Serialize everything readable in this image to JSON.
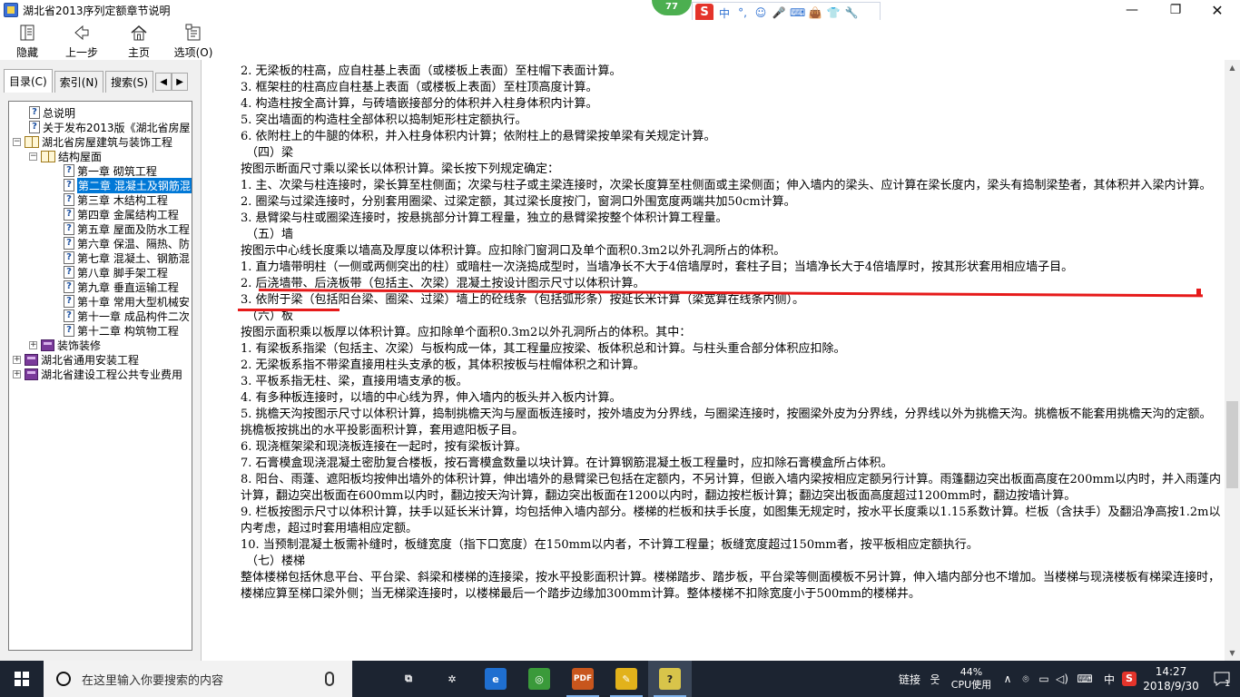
{
  "window": {
    "title": "湖北省2013序列定额章节说明",
    "minimize": "—",
    "maximize": "❐",
    "close": "✕"
  },
  "ime": {
    "badge": "77",
    "logo": "S",
    "items": [
      "中",
      "°,",
      "☺",
      "🎤",
      "⌨",
      "👜",
      "👕",
      "🔧"
    ]
  },
  "toolbar": {
    "hide_label": "隐藏",
    "back_label": "上一步",
    "home_label": "主页",
    "options_label": "选项(O)"
  },
  "nav": {
    "tabs": [
      "目录(C)",
      "索引(N)",
      "搜索(S)"
    ],
    "tab_prev": "◀",
    "tab_next": "▶",
    "tree": [
      {
        "indent": 0,
        "expander": "",
        "icon": "doc",
        "label": "总说明"
      },
      {
        "indent": 0,
        "expander": "",
        "icon": "doc",
        "label": "关于发布2013版《湖北省房屋"
      },
      {
        "indent": -1,
        "expander": "−",
        "icon": "book-open",
        "label": "湖北省房屋建筑与装饰工程"
      },
      {
        "indent": 1,
        "expander": "−",
        "icon": "book-open",
        "label": "结构屋面"
      },
      {
        "indent": 2,
        "expander": "",
        "icon": "doc",
        "label": "第一章  砌筑工程"
      },
      {
        "indent": 2,
        "expander": "",
        "icon": "doc",
        "label": "第二章  混凝土及钢筋混",
        "selected": true
      },
      {
        "indent": 2,
        "expander": "",
        "icon": "doc",
        "label": "第三章  木结构工程"
      },
      {
        "indent": 2,
        "expander": "",
        "icon": "doc",
        "label": "第四章  金属结构工程"
      },
      {
        "indent": 2,
        "expander": "",
        "icon": "doc",
        "label": "第五章  屋面及防水工程"
      },
      {
        "indent": 2,
        "expander": "",
        "icon": "doc",
        "label": "第六章  保温、隔热、防"
      },
      {
        "indent": 2,
        "expander": "",
        "icon": "doc",
        "label": "第七章  混凝土、钢筋混"
      },
      {
        "indent": 2,
        "expander": "",
        "icon": "doc",
        "label": "第八章  脚手架工程"
      },
      {
        "indent": 2,
        "expander": "",
        "icon": "doc",
        "label": "第九章  垂直运输工程"
      },
      {
        "indent": 2,
        "expander": "",
        "icon": "doc",
        "label": "第十章  常用大型机械安"
      },
      {
        "indent": 2,
        "expander": "",
        "icon": "doc",
        "label": "第十一章  成品构件二次"
      },
      {
        "indent": 2,
        "expander": "",
        "icon": "doc",
        "label": "第十二章  构筑物工程"
      },
      {
        "indent": 1,
        "expander": "+",
        "icon": "book",
        "label": "装饰装修"
      },
      {
        "indent": -1,
        "expander": "+",
        "icon": "book",
        "label": "湖北省通用安装工程"
      },
      {
        "indent": -1,
        "expander": "+",
        "icon": "book",
        "label": "湖北省建设工程公共专业费用"
      }
    ]
  },
  "content": {
    "lines": [
      {
        "text": "2. 无梁板的柱高，应自柱基上表面（或楼板上表面）至柱帽下表面计算。"
      },
      {
        "text": "3. 框架柱的柱高应自柱基上表面（或楼板上表面）至柱顶高度计算。"
      },
      {
        "text": "4. 构造柱按全高计算，与砖墙嵌接部分的体积并入柱身体积内计算。"
      },
      {
        "text": "5. 突出墙面的构造柱全部体积以捣制矩形柱定额执行。"
      },
      {
        "text": "6. 依附柱上的牛腿的体积，并入柱身体积内计算；依附柱上的悬臂梁按单梁有关规定计算。"
      },
      {
        "text": "（四）梁",
        "heading": true
      },
      {
        "text": "按图示断面尺寸乘以梁长以体积计算。梁长按下列规定确定："
      },
      {
        "text": "1. 主、次梁与柱连接时，梁长算至柱侧面；次梁与柱子或主梁连接时，次梁长度算至柱侧面或主梁侧面；伸入墙内的梁头、应计算在梁长度内，梁头有捣制梁垫者，其体积并入梁内计算。",
        "wrap": true
      },
      {
        "text": "2. 圈梁与过梁连接时，分别套用圈梁、过梁定额，其过梁长度按门，窗洞口外围宽度两端共加50cm计算。"
      },
      {
        "text": "3. 悬臂梁与柱或圈梁连接时，按悬挑部分计算工程量，独立的悬臂梁按整个体积计算工程量。"
      },
      {
        "text": "（五）墙",
        "heading": true
      },
      {
        "text": "按图示中心线长度乘以墙高及厚度以体积计算。应扣除门窗洞口及单个面积0.3m2以外孔洞所占的体积。"
      },
      {
        "text": "1. 直力墙带明柱（一侧或两侧突出的柱）或暗柱一次浇捣成型时，当墙净长不大于4倍墙厚时，套柱子目；当墙净长大于4倍墙厚时，按其形状套用相应墙子目。",
        "wrap": true
      },
      {
        "text": "2. 后浇墙带、后浇板带（包括主、次梁）混凝土按设计图示尺寸以体积计算。"
      },
      {
        "text": "3. 依附于梁（包括阳台梁、圈梁、过梁）墙上的砼线条（包括弧形条）按延长米计算（梁宽算在线条内侧）。"
      },
      {
        "text": "（六）板",
        "heading": true
      },
      {
        "text": "按图示面积乘以板厚以体积计算。应扣除单个面积0.3m2以外孔洞所占的体积。其中："
      },
      {
        "text": "1. 有梁板系指梁（包括主、次梁）与板构成一体，其工程量应按梁、板体积总和计算。与柱头重合部分体积应扣除。"
      },
      {
        "text": "2. 无梁板系指不带梁直接用柱头支承的板，其体积按板与柱帽体积之和计算。"
      },
      {
        "text": "3. 平板系指无柱、梁，直接用墙支承的板。"
      },
      {
        "text": "4. 有多种板连接时，以墙的中心线为界，伸入墙内的板头并入板内计算。"
      },
      {
        "text": "5. 挑檐天沟按图示尺寸以体积计算，捣制挑檐天沟与屋面板连接时，按外墙皮为分界线，与圈梁连接时，按圈梁外皮为分界线，分界线以外为挑檐天沟。挑檐板不能套用挑檐天沟的定额。挑檐板按挑出的水平投影面积计算，套用遮阳板子目。",
        "wrap": true
      },
      {
        "text": "6. 现浇框架梁和现浇板连接在一起时，按有梁板计算。"
      },
      {
        "text": "7. 石膏模盒现浇混凝土密肋复合楼板，按石膏模盒数量以块计算。在计算钢筋混凝土板工程量时，应扣除石膏模盒所占体积。"
      },
      {
        "text": "8. 阳台、雨蓬、遮阳板均按伸出墙外的体积计算，伸出墙外的悬臂梁已包括在定额内，不另计算，但嵌入墙内梁按相应定额另行计算。雨篷翻边突出板面高度在200mm以内时，并入雨蓬内计算，翻边突出板面在600mm以内时，翻边按天沟计算，翻边突出板面在1200以内时，翻边按栏板计算；翻边突出板面高度超过1200mm时，翻边按墙计算。",
        "wrap": true
      },
      {
        "text": "9. 栏板按图示尺寸以体积计算，扶手以延长米计算，均包括伸入墙内部分。楼梯的栏板和扶手长度，如图集无规定时，按水平长度乘以1.15系数计算。栏板（含扶手）及翻沿净高按1.2m以内考虑，超过时套用墙相应定额。",
        "wrap": true
      },
      {
        "text": "10. 当预制混凝土板需补缝时，板缝宽度（指下口宽度）在150mm以内者，不计算工程量；板缝宽度超过150mm者，按平板相应定额执行。"
      },
      {
        "text": "（七）楼梯",
        "heading": true
      },
      {
        "text": "整体楼梯包括休息平台、平台梁、斜梁和楼梯的连接梁，按水平投影面积计算。楼梯踏步、踏步板，平台梁等侧面模板不另计算，伸入墙内部分也不增加。当楼梯与现浇楼板有梯梁连接时，楼梯应算至梯口梁外侧；当无梯梁连接时，以楼梯最后一个踏步边缘加300mm计算。整体楼梯不扣除宽度小于500mm的楼梯井。",
        "wrap": true
      }
    ]
  },
  "taskbar": {
    "search_placeholder": "在这里输入你要搜索的内容",
    "apps": [
      {
        "name": "task-view",
        "glyph": "⧉",
        "color": "transparent"
      },
      {
        "name": "fan-app",
        "glyph": "✲",
        "color": "transparent"
      },
      {
        "name": "ie-browser",
        "glyph": "e",
        "color": "#1f6fd0"
      },
      {
        "name": "360-browser",
        "glyph": "◎",
        "color": "#3a9a3a"
      },
      {
        "name": "pdf-reader",
        "glyph": "PDF",
        "color": "#c8561d"
      },
      {
        "name": "notes-app",
        "glyph": "✎",
        "color": "#e2b21b"
      },
      {
        "name": "chm-help",
        "glyph": "?",
        "color": "#d8c44a"
      }
    ],
    "tray_link": "链接",
    "cpu_percent": "44%",
    "cpu_label": "CPU使用",
    "ime_lang": "中",
    "time": "14:27",
    "date": "2018/9/30",
    "notify_count": "1"
  }
}
